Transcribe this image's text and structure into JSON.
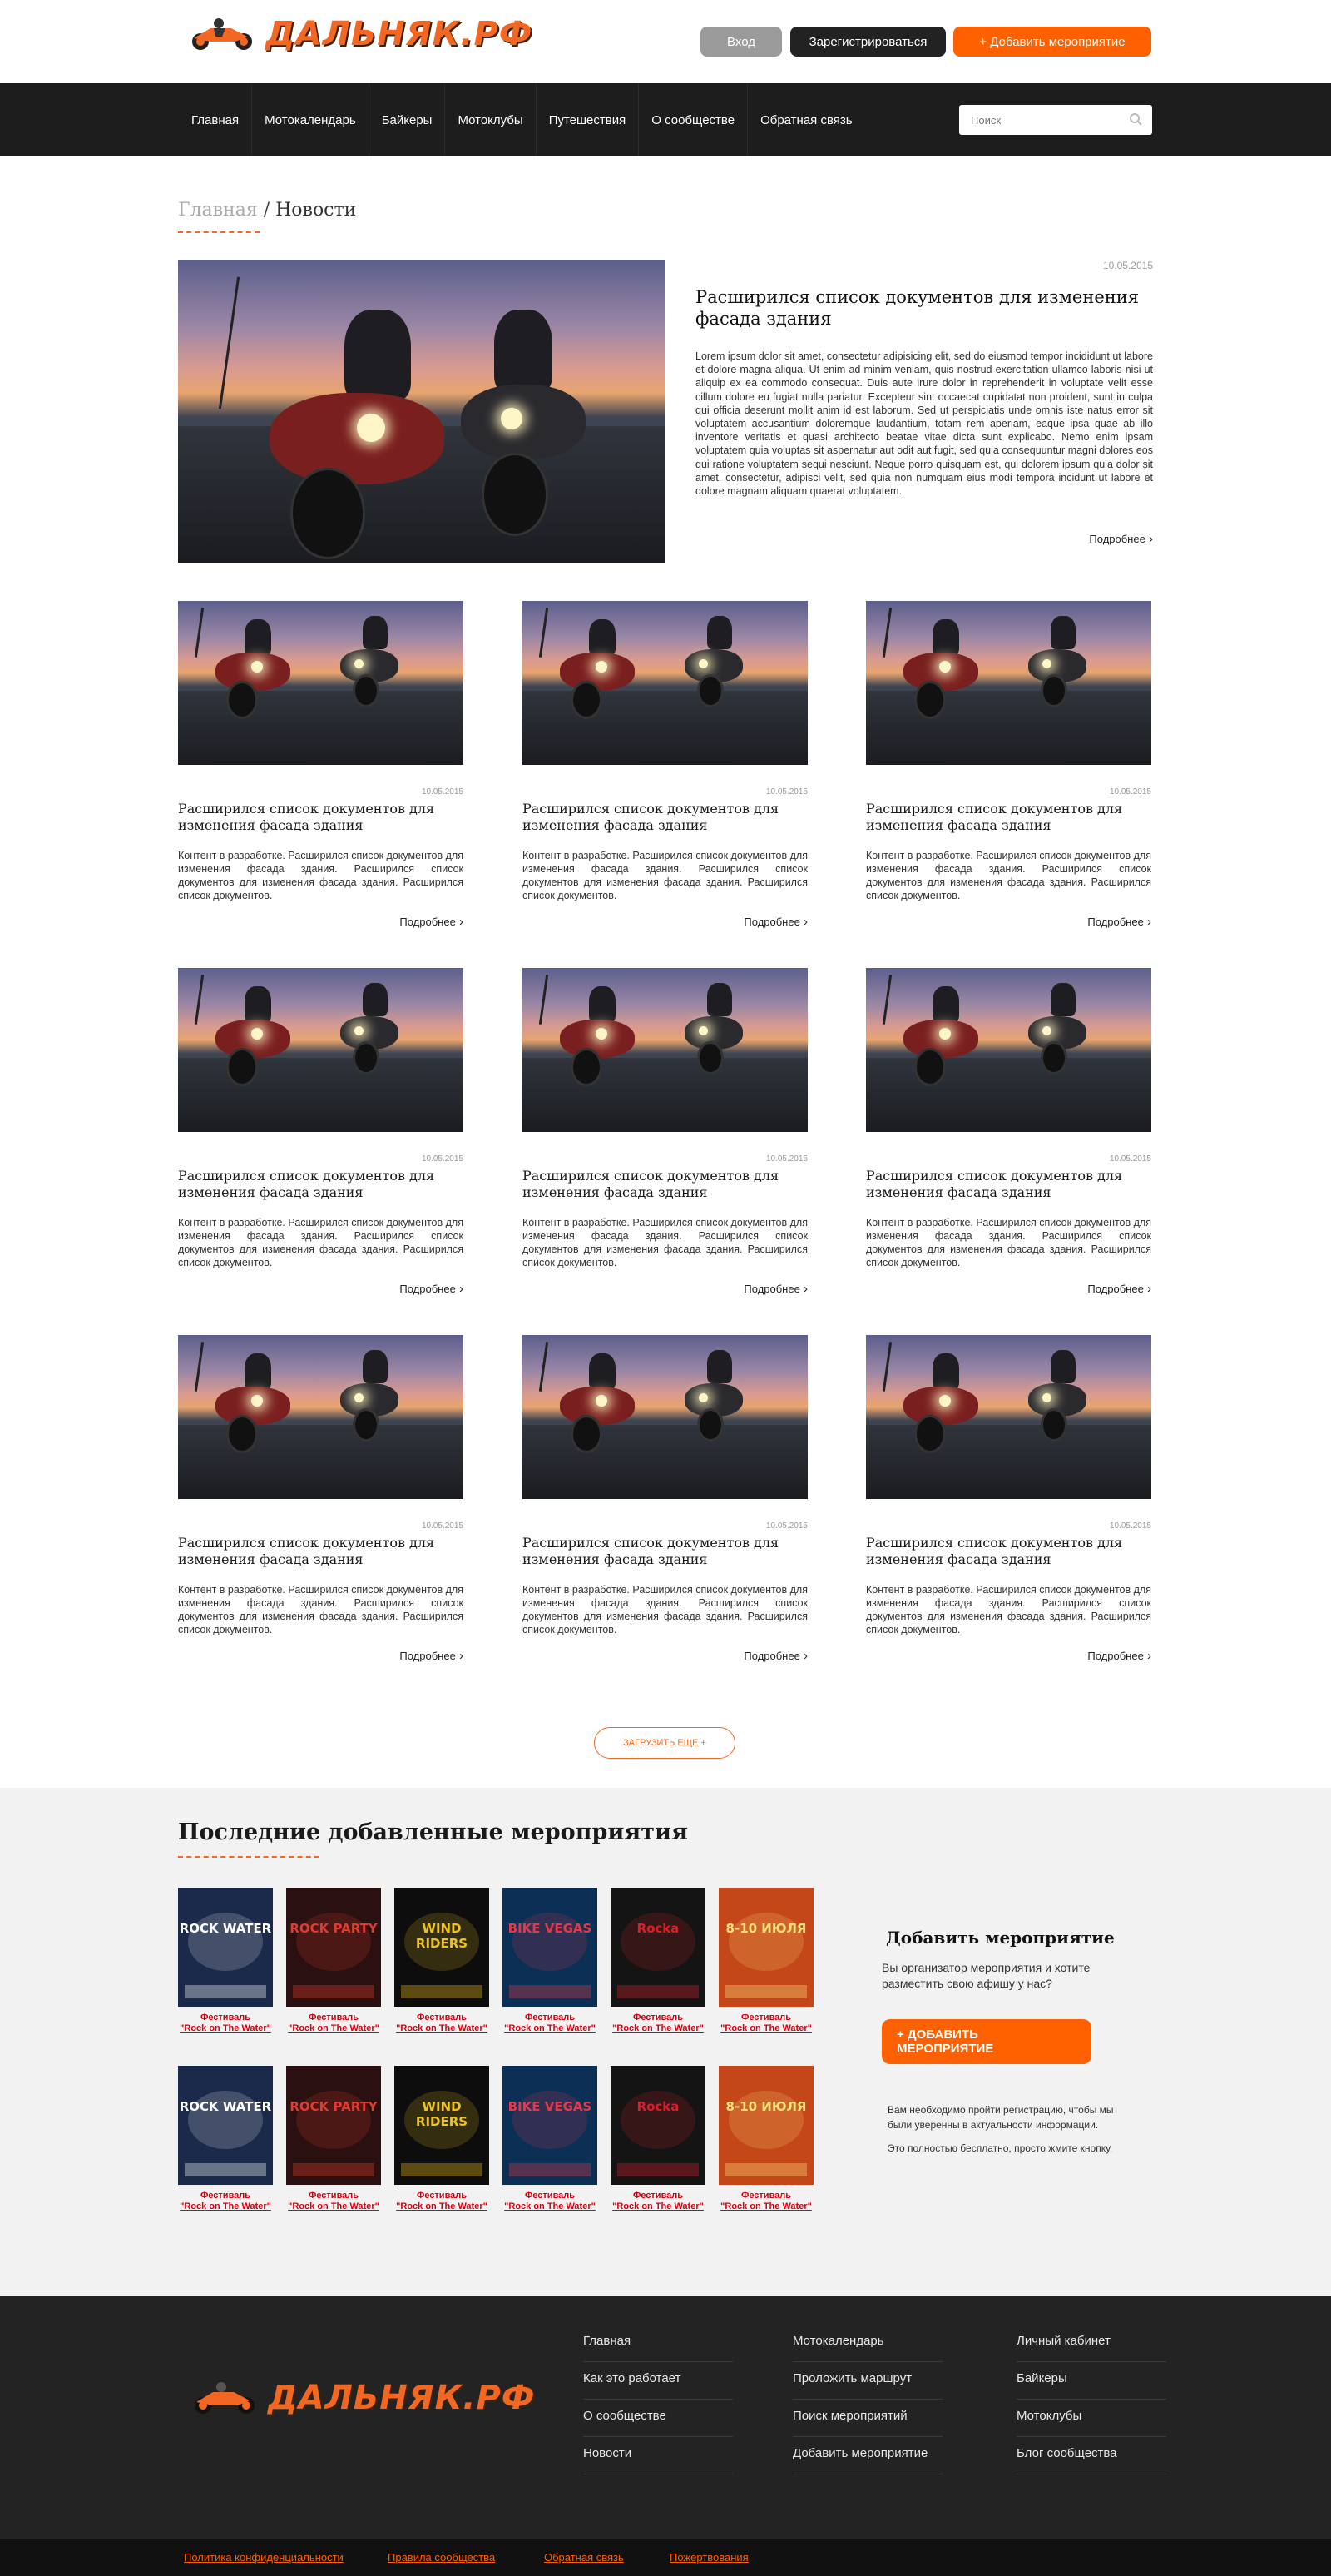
{
  "header": {
    "logo_text": "ДАЛЬНЯК.РФ",
    "login_label": "Вход",
    "register_label": "Зарегистрироваться",
    "add_event_label": "+ Добавить мероприятие"
  },
  "nav": {
    "items": [
      "Главная",
      "Мотокалендарь",
      "Байкеры",
      "Мотоклубы",
      "Путешествия",
      "О сообществе",
      "Обратная связь"
    ],
    "search_placeholder": "Поиск"
  },
  "breadcrumb": {
    "home": "Главная",
    "separator": "/",
    "current": "Новости"
  },
  "featured": {
    "date": "10.05.2015",
    "title": "Расширился список документов для изменения фасада здания",
    "text": "Lorem ipsum dolor sit amet, consectetur adipisicing elit, sed do eiusmod tempor incididunt ut labore et dolore magna aliqua. Ut enim ad minim veniam, quis nostrud exercitation ullamco laboris nisi ut aliquip ex ea commodo consequat. Duis aute irure dolor in reprehenderit in voluptate velit esse cillum dolore eu fugiat nulla pariatur. Excepteur sint occaecat cupidatat non proident, sunt in culpa qui officia deserunt mollit anim id est laborum. Sed ut perspiciatis unde omnis iste natus error sit voluptatem accusantium doloremque laudantium, totam rem aperiam, eaque ipsa quae ab illo inventore veritatis et quasi architecto beatae vitae dicta sunt explicabo. Nemo enim ipsam voluptatem quia voluptas sit aspernatur aut odit aut fugit, sed quia consequuntur magni dolores eos qui ratione voluptatem sequi nesciunt. Neque porro quisquam est, qui dolorem ipsum quia dolor sit amet, consectetur, adipisci velit, sed quia non numquam eius modi tempora incidunt ut labore et dolore magnam aliquam quaerat voluptatem.",
    "more": "Подробнее"
  },
  "cards": [
    {
      "date": "10.05.2015",
      "title": "Расширился список документов для изменения фасада здания",
      "text": "Контент в разработке. Расширился список документов для изменения фасада здания. Расширился список документов для изменения фасада здания. Расширился список документов.",
      "more": "Подробнее"
    },
    {
      "date": "10.05.2015",
      "title": "Расширился список документов для изменения фасада здания",
      "text": "Контент в разработке. Расширился список документов для изменения фасада здания. Расширился список документов для изменения фасада здания. Расширился список документов.",
      "more": "Подробнее"
    },
    {
      "date": "10.05.2015",
      "title": "Расширился список документов для изменения фасада здания",
      "text": "Контент в разработке. Расширился список документов для изменения фасада здания. Расширился список документов для изменения фасада здания. Расширился список документов.",
      "more": "Подробнее"
    },
    {
      "date": "10.05.2015",
      "title": "Расширился список документов для изменения фасада здания",
      "text": "Контент в разработке. Расширился список документов для изменения фасада здания. Расширился список документов для изменения фасада здания. Расширился список документов.",
      "more": "Подробнее"
    },
    {
      "date": "10.05.2015",
      "title": "Расширился список документов для изменения фасада здания",
      "text": "Контент в разработке. Расширился список документов для изменения фасада здания. Расширился список документов для изменения фасада здания. Расширился список документов.",
      "more": "Подробнее"
    },
    {
      "date": "10.05.2015",
      "title": "Расширился список документов для изменения фасада здания",
      "text": "Контент в разработке. Расширился список документов для изменения фасада здания. Расширился список документов для изменения фасада здания. Расширился список документов.",
      "more": "Подробнее"
    },
    {
      "date": "10.05.2015",
      "title": "Расширился список документов для изменения фасада здания",
      "text": "Контент в разработке. Расширился список документов для изменения фасада здания. Расширился список документов для изменения фасада здания. Расширился список документов.",
      "more": "Подробнее"
    },
    {
      "date": "10.05.2015",
      "title": "Расширился список документов для изменения фасада здания",
      "text": "Контент в разработке. Расширился список документов для изменения фасада здания. Расширился список документов для изменения фасада здания. Расширился список документов.",
      "more": "Подробнее"
    },
    {
      "date": "10.05.2015",
      "title": "Расширился список документов для изменения фасада здания",
      "text": "Контент в разработке. Расширился список документов для изменения фасада здания. Расширился список документов для изменения фасада здания. Расширился список документов.",
      "more": "Подробнее"
    }
  ],
  "load_more": "ЗАГРУЗИТЬ ЕЩЕ +",
  "events": {
    "title": "Последние добавленные мероприятия",
    "posters": [
      {
        "caption_1": "Фестиваль",
        "caption_2": "\"Rock on The Water\"",
        "art": "ROCK WATER",
        "bg": "#1b2a4a",
        "fg": "#ffffff"
      },
      {
        "caption_1": "Фестиваль",
        "caption_2": "\"Rock on The Water\"",
        "art": "ROCK PARTY",
        "bg": "#2a1010",
        "fg": "#e33b2e"
      },
      {
        "caption_1": "Фестиваль",
        "caption_2": "\"Rock on The Water\"",
        "art": "WIND RIDERS",
        "bg": "#0d0d0d",
        "fg": "#f0c419"
      },
      {
        "caption_1": "Фестиваль",
        "caption_2": "\"Rock on The Water\"",
        "art": "BIKE VEGAS",
        "bg": "#0c2f55",
        "fg": "#e63946"
      },
      {
        "caption_1": "Фестиваль",
        "caption_2": "\"Rock on The Water\"",
        "art": "Rocka",
        "bg": "#141414",
        "fg": "#d81f2a"
      },
      {
        "caption_1": "Фестиваль",
        "caption_2": "\"Rock on The Water\"",
        "art": "8-10 ИЮЛЯ",
        "bg": "#c4471a",
        "fg": "#ffe27a"
      },
      {
        "caption_1": "Фестиваль",
        "caption_2": "\"Rock on The Water\"",
        "art": "ROCK WATER",
        "bg": "#1b2a4a",
        "fg": "#ffffff"
      },
      {
        "caption_1": "Фестиваль",
        "caption_2": "\"Rock on The Water\"",
        "art": "ROCK PARTY",
        "bg": "#2a1010",
        "fg": "#e33b2e"
      },
      {
        "caption_1": "Фестиваль",
        "caption_2": "\"Rock on The Water\"",
        "art": "WIND RIDERS",
        "bg": "#0d0d0d",
        "fg": "#f0c419"
      },
      {
        "caption_1": "Фестиваль",
        "caption_2": "\"Rock on The Water\"",
        "art": "BIKE VEGAS",
        "bg": "#0c2f55",
        "fg": "#e63946"
      },
      {
        "caption_1": "Фестиваль",
        "caption_2": "\"Rock on The Water\"",
        "art": "Rocka",
        "bg": "#141414",
        "fg": "#d81f2a"
      },
      {
        "caption_1": "Фестиваль",
        "caption_2": "\"Rock on The Water\"",
        "art": "8-10 ИЮЛЯ",
        "bg": "#c4471a",
        "fg": "#ffe27a"
      }
    ],
    "add_title": "Добавить мероприятие",
    "add_text": "Вы организатор мероприятия и хотите разместить свою афишу у нас?",
    "add_button": "+ ДОБАВИТЬ МЕРОПРИЯТИЕ",
    "note_1": "Вам необходимо пройти регистрацию, чтобы мы были уверенны в актуальности информации.",
    "note_2": "Это полностью бесплатно, просто жмите кнопку."
  },
  "footer": {
    "logo_text": "ДАЛЬНЯК.РФ",
    "col1": [
      "Главная",
      "Как это работает",
      "О сообществе",
      "Новости"
    ],
    "col2": [
      "Мотокалендарь",
      "Проложить маршрут",
      "Поиск мероприятий",
      "Добавить мероприятие"
    ],
    "col3": [
      "Личный кабинет",
      "Байкеры",
      "Мотоклубы",
      "Блог сообщества"
    ],
    "bottom_links": [
      "Политика конфиденциальности",
      "Правила сообщества",
      "Обратная связь",
      "Пожертвования"
    ]
  },
  "colors": {
    "accent": "#ff6000",
    "dark": "#1d1d1d",
    "footer": "#232323",
    "event_caption": "#d7000f"
  }
}
